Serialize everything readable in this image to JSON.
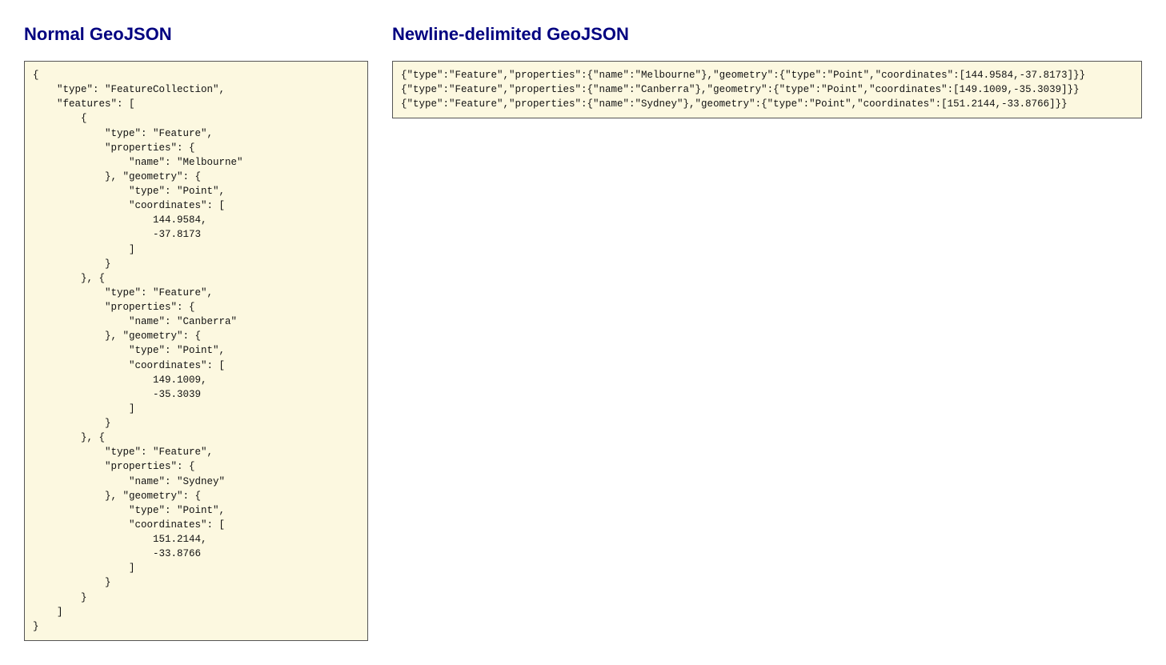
{
  "left": {
    "heading": "Normal GeoJSON",
    "code": "{\n    \"type\": \"FeatureCollection\",\n    \"features\": [\n        {\n            \"type\": \"Feature\",\n            \"properties\": {\n                \"name\": \"Melbourne\"\n            }, \"geometry\": {\n                \"type\": \"Point\",\n                \"coordinates\": [\n                    144.9584,\n                    -37.8173\n                ]\n            }\n        }, {\n            \"type\": \"Feature\",\n            \"properties\": {\n                \"name\": \"Canberra\"\n            }, \"geometry\": {\n                \"type\": \"Point\",\n                \"coordinates\": [\n                    149.1009,\n                    -35.3039\n                ]\n            }\n        }, {\n            \"type\": \"Feature\",\n            \"properties\": {\n                \"name\": \"Sydney\"\n            }, \"geometry\": {\n                \"type\": \"Point\",\n                \"coordinates\": [\n                    151.2144,\n                    -33.8766\n                ]\n            }\n        }\n    ]\n}"
  },
  "right": {
    "heading": "Newline-delimited GeoJSON",
    "code": "{\"type\":\"Feature\",\"properties\":{\"name\":\"Melbourne\"},\"geometry\":{\"type\":\"Point\",\"coordinates\":[144.9584,-37.8173]}}\n{\"type\":\"Feature\",\"properties\":{\"name\":\"Canberra\"},\"geometry\":{\"type\":\"Point\",\"coordinates\":[149.1009,-35.3039]}}\n{\"type\":\"Feature\",\"properties\":{\"name\":\"Sydney\"},\"geometry\":{\"type\":\"Point\",\"coordinates\":[151.2144,-33.8766]}}"
  }
}
